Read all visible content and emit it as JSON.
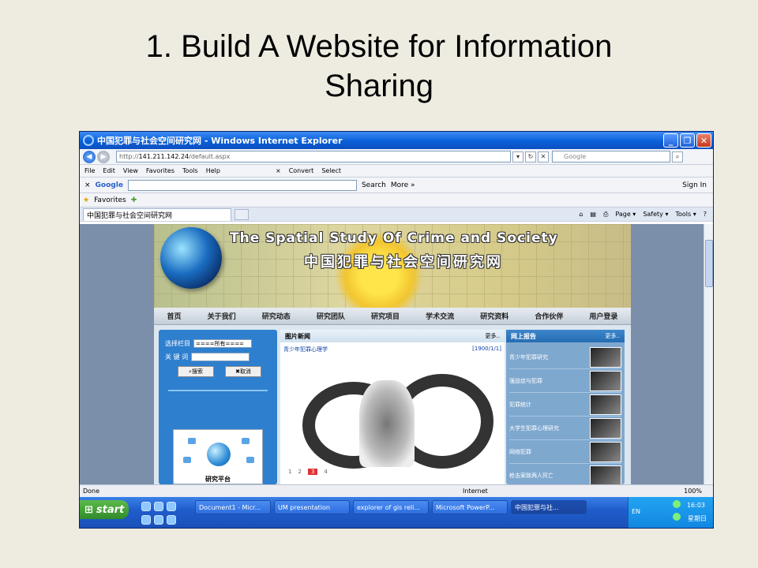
{
  "slide": {
    "title_line1": "1. Build A Website for Information",
    "title_line2": "Sharing"
  },
  "browser": {
    "window_title": "中国犯罪与社会空间研究网 - Windows Internet Explorer",
    "address_prefix": "http://",
    "address_host": "141.211.142.24",
    "address_path": "/default.aspx",
    "search_placeholder": "Google",
    "menu": [
      "File",
      "Edit",
      "View",
      "Favorites",
      "Tools",
      "Help"
    ],
    "toolbar_convert": "Convert",
    "toolbar_select": "Select",
    "google_label": "Google",
    "google_search": "Search",
    "google_more": "More »",
    "sign_in": "Sign In",
    "favorites": "Favorites",
    "tab_title": "中国犯罪与社会空间研究网",
    "commands": [
      "Page ▾",
      "Safety ▾",
      "Tools ▾"
    ],
    "status_left": "Done",
    "status_zone": "Internet",
    "status_zoom": "100%"
  },
  "site": {
    "banner_en": "The Spatial Study Of Crime and Society",
    "banner_cn": "中国犯罪与社会空间研究网",
    "nav": [
      "首页",
      "关于我们",
      "研究动态",
      "研究团队",
      "研究项目",
      "学术交流",
      "研究资料",
      "合作伙伴",
      "用户登录"
    ],
    "search_column_label": "选择栏目",
    "search_column_value": "====所有====",
    "search_keyword_label": "关 键 词",
    "search_button": "搜索",
    "cancel_button": "取消",
    "platform_label": "研究平台",
    "photo_news_title": "图片新闻",
    "more": "更多..",
    "news_item": "青少年犯罪心理学",
    "news_date": "[1900/1/1]",
    "pager": [
      "1",
      "2",
      "3",
      "4"
    ],
    "reports_title": "网上报告",
    "reports": [
      "青少年犯罪研究",
      "强迫症与犯罪",
      "犯罪统计",
      "大学生犯罪心理研究",
      "网络犯罪",
      "枪击案致两人死亡"
    ]
  },
  "taskbar": {
    "start": "start",
    "tasks": [
      "Document1 - Micr...",
      "UM presentation",
      "explorer of gis reli...",
      "Microsoft PowerP...",
      "中国犯罪与社..."
    ],
    "lang": "EN",
    "time": "16:03",
    "day": "星期日"
  }
}
